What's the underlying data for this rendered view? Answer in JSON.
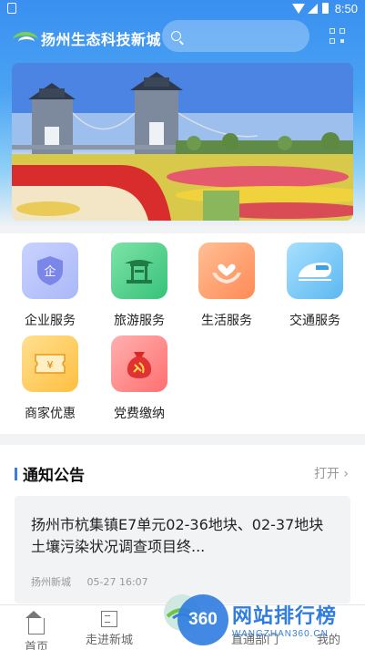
{
  "status_bar": {
    "time": "8:50"
  },
  "header": {
    "brand_name": "扬州生态科技新城",
    "search_placeholder": ""
  },
  "services": [
    {
      "label": "企业服务",
      "icon": "enterprise-shield-icon",
      "color": "#9aa6f2"
    },
    {
      "label": "旅游服务",
      "icon": "pavilion-icon",
      "color": "#4fd08c"
    },
    {
      "label": "生活服务",
      "icon": "heart-hands-icon",
      "color": "#ff9566"
    },
    {
      "label": "交通服务",
      "icon": "train-icon",
      "color": "#5dbdf2"
    },
    {
      "label": "商家优惠",
      "icon": "coupon-icon",
      "color": "#ffc454"
    },
    {
      "label": "党费缴纳",
      "icon": "party-money-bag-icon",
      "color": "#ff7b7b"
    }
  ],
  "notice": {
    "title": "通知公告",
    "open_label": "打开 ›",
    "items": [
      {
        "title": "扬州市杭集镇E7单元02-36地块、02-37地块土壤污染状况调查项目终...",
        "source": "扬州新城",
        "date": "05-27 16:07"
      }
    ]
  },
  "bottom_nav": {
    "items": [
      {
        "label": "首页",
        "icon": "home-icon"
      },
      {
        "label": "走进新城",
        "icon": "building-icon"
      },
      {
        "label": "直通部门",
        "icon": "department-icon"
      },
      {
        "label": "我的",
        "icon": "user-icon"
      }
    ]
  },
  "watermark": {
    "circle": "360",
    "text": "网站排行榜",
    "sub": "WANGZHAN360.CN"
  }
}
